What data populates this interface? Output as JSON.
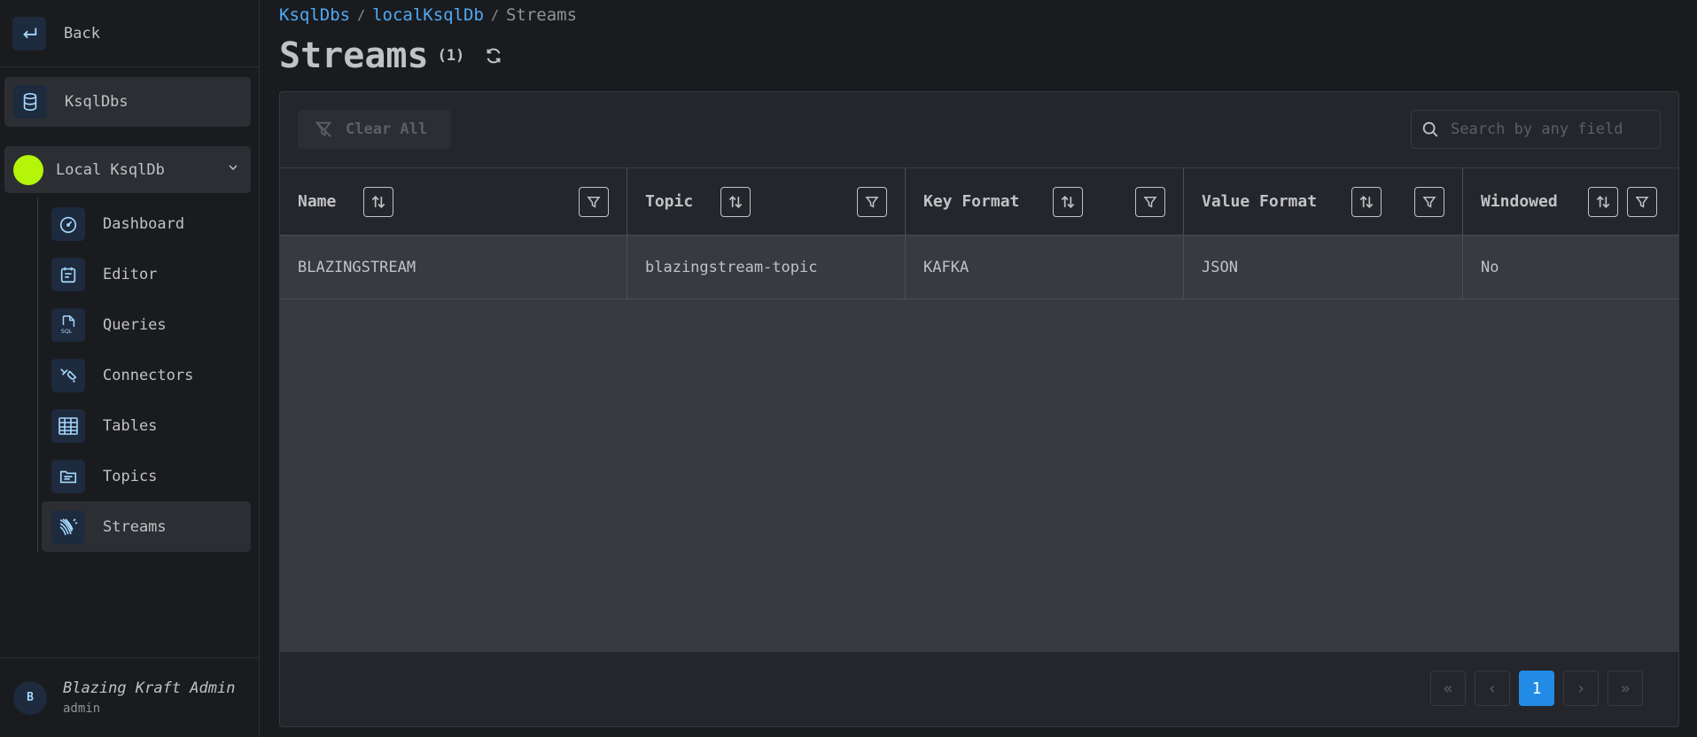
{
  "sidebar": {
    "back_label": "Back",
    "section_label": "KsqlDbs",
    "environment": {
      "name": "Local KsqlDb",
      "color": "#b4f50a"
    },
    "items": [
      {
        "label": "Dashboard",
        "icon": "gauge-icon"
      },
      {
        "label": "Editor",
        "icon": "calendar-editor-icon"
      },
      {
        "label": "Queries",
        "icon": "sql-file-icon"
      },
      {
        "label": "Connectors",
        "icon": "plug-connector-icon"
      },
      {
        "label": "Tables",
        "icon": "table-icon"
      },
      {
        "label": "Topics",
        "icon": "folder-icon"
      },
      {
        "label": "Streams",
        "icon": "stream-icon",
        "active": true
      }
    ],
    "user": {
      "initial": "B",
      "name": "Blazing Kraft Admin",
      "role": "admin"
    }
  },
  "breadcrumb": {
    "items": [
      "KsqlDbs",
      "localKsqlDb"
    ],
    "current": "Streams"
  },
  "page": {
    "title": "Streams",
    "count": "(1)"
  },
  "toolbar": {
    "clear_label": "Clear All",
    "search_placeholder": "Search by any field"
  },
  "table": {
    "columns": [
      "Name",
      "Topic",
      "Key Format",
      "Value Format",
      "Windowed"
    ],
    "rows": [
      [
        "BLAZINGSTREAM",
        "blazingstream-topic",
        "KAFKA",
        "JSON",
        "No"
      ]
    ]
  },
  "pagination": {
    "first": "«",
    "prev": "‹",
    "current": "1",
    "next": "›",
    "last": "»"
  },
  "colors": {
    "accent": "#228be6",
    "link": "#4dabf7",
    "background": "#1a1b1e"
  }
}
